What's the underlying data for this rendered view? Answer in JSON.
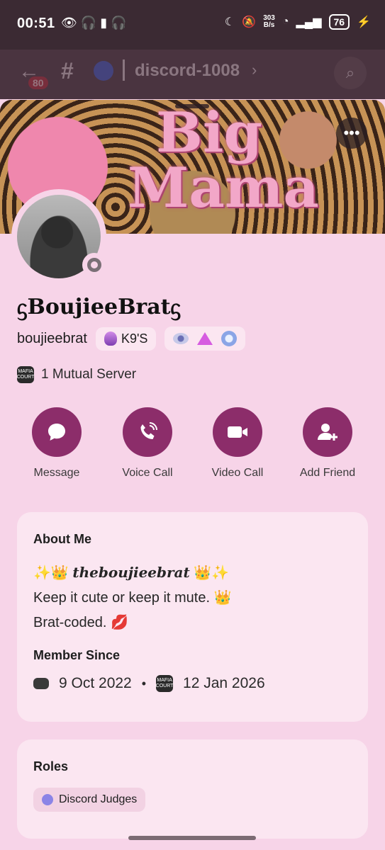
{
  "status_bar": {
    "time": "00:51",
    "left_icons": "👁 🎧 ▮ 🎧",
    "speed_top": "303",
    "speed_bottom": "B/s",
    "battery": "76"
  },
  "app_bar": {
    "unread_badge": "80",
    "channel_name": "discord-1008"
  },
  "banner": {
    "title_line1": "Big",
    "title_line2": "Mama"
  },
  "profile": {
    "display_name": "ᦓBoujieeBratᦓ",
    "username": "boujieebrat",
    "tag": "K9'S",
    "mutual_servers": "1 Mutual Server",
    "mutual_icon_text": "MAFIA COURT"
  },
  "actions": [
    {
      "label": "Message",
      "icon": "message-icon"
    },
    {
      "label": "Voice Call",
      "icon": "phone-icon"
    },
    {
      "label": "Video Call",
      "icon": "video-icon"
    },
    {
      "label": "Add Friend",
      "icon": "add-friend-icon"
    }
  ],
  "about": {
    "heading": "About Me",
    "line1_pre": "✨👑 ",
    "line1_name": "theboujieebrat",
    "line1_post": " 👑✨",
    "line2": "Keep it cute or keep it mute. 👑",
    "line3": "Brat-coded. 💋",
    "member_since_heading": "Member Since",
    "discord_since": "9 Oct 2022",
    "separator": "•",
    "server_since": "12 Jan 2026"
  },
  "roles": {
    "heading": "Roles",
    "items": [
      "Discord Judges"
    ]
  },
  "colors": {
    "accent": "#8c2d6a",
    "sheet_bg": "#f7d4e8",
    "card_bg": "#fbe6f1"
  }
}
